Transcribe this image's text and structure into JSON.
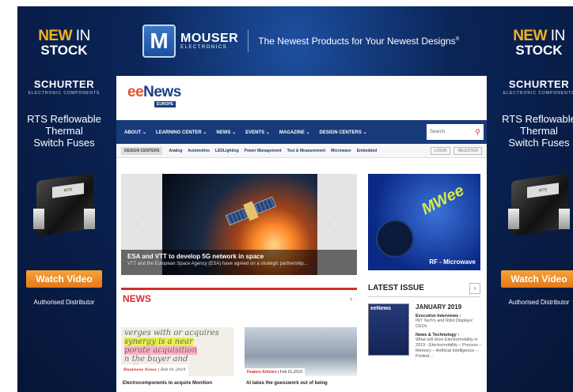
{
  "side_ad": {
    "new": "NEW",
    "in": "IN",
    "stock": "STOCK",
    "brand": "SCHURTER",
    "brand_sub": "ELECTRONIC COMPONENTS",
    "product_line1": "RTS Reflowable",
    "product_line2": "Thermal",
    "product_line3": "Switch Fuses",
    "cta": "Watch Video",
    "distributor": "Authorised Distributor"
  },
  "banner": {
    "logo_letter": "M",
    "brand": "MOUSER",
    "brand_sub": "ELECTRONICS",
    "tagline": "The Newest Products for Your Newest Designs",
    "tagline_mark": "®"
  },
  "site": {
    "logo_ee": "ee",
    "logo_news": "News",
    "logo_region": "EUROPE"
  },
  "nav": {
    "items": [
      "ABOUT",
      "LEARNING CENTER",
      "NEWS",
      "EVENTS",
      "MAGAZINE",
      "DESIGN CENTERS"
    ],
    "search_placeholder": "Search"
  },
  "design_centers": {
    "label": "DESIGN CENTERS",
    "items": [
      "Analog",
      "Automotive",
      "LEDLighting",
      "Power Management",
      "Test & Measurement",
      "Microwave",
      "Embedded"
    ],
    "login": "LOGIN",
    "register": "REGISTER"
  },
  "hero": {
    "title": "ESA and VTT to develop 5G network in space",
    "desc": "VTT and the European Space Agency (ESA) have agreed on a strategic partnership..."
  },
  "rf_box": {
    "brand": "MWee",
    "label": "RF - Microwave"
  },
  "news": {
    "heading": "NEWS",
    "cards": [
      {
        "category": "Business News",
        "date": "Feb 01,2019",
        "title": "Electrocomponents to acquire Monition",
        "image_text": [
          "verges with or acquires",
          "synergy is a near",
          "porate acquisition",
          "n the buyer and",
          "sell"
        ]
      },
      {
        "category": "Feature Articles",
        "date": "Feb 01,2019",
        "title": "AI takes the guesswork out of being"
      }
    ]
  },
  "latest_issue": {
    "heading": "LATEST ISSUE",
    "cover_title": "eeNews",
    "month": "JANUARY 2019",
    "sections": [
      {
        "title": "Executive Interviews :",
        "body": "INT Tech's and Rdot Displays' CEOs"
      },
      {
        "title": "News & Technology :",
        "body": "What will drive Electromobility in 2019 - Electromobility – Process – Memory – Artificial Intelligence – Printed..."
      }
    ]
  },
  "colors": {
    "navy": "#173a7a",
    "accent_red": "#d32d2d",
    "ad_orange": "#e5781a",
    "ad_gold": "#f3b221"
  }
}
